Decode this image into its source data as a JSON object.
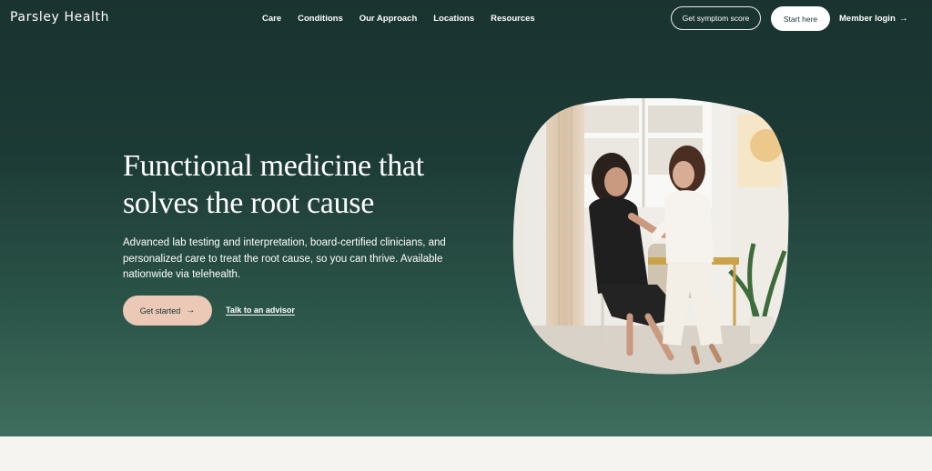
{
  "brand": {
    "logo_text": "Parsley Health"
  },
  "nav": {
    "items": [
      {
        "label": "Care"
      },
      {
        "label": "Conditions"
      },
      {
        "label": "Our Approach"
      },
      {
        "label": "Locations"
      },
      {
        "label": "Resources"
      }
    ],
    "symptom_score_label": "Get symptom score",
    "start_here_label": "Start here",
    "member_login_label": "Member login"
  },
  "hero": {
    "headline": "Functional medicine that solves the root cause",
    "description": "Advanced lab testing and interpretation, board-certified clinicians, and personalized care to treat the root cause, so you can thrive. Available nationwide via telehealth.",
    "cta_primary": "Get started",
    "cta_secondary": "Talk to an advisor",
    "image_alt": "Clinician examining a patient's arm in a bright office"
  },
  "icons": {
    "arrow": "→"
  },
  "colors": {
    "hero_dark": "#1a3330",
    "hero_light": "#3f6e5e",
    "cta_peach": "#ecc9b6",
    "below_fold": "#f6f4f0"
  }
}
